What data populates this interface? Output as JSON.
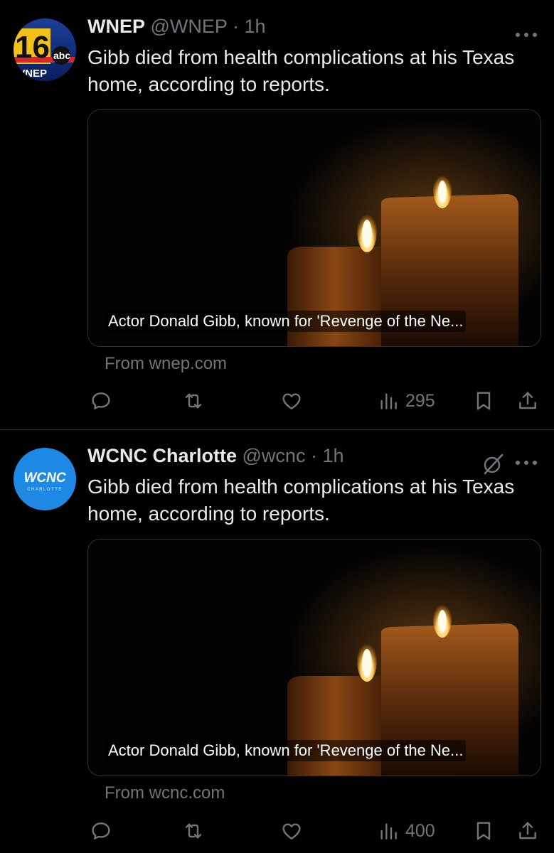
{
  "tweets": [
    {
      "avatar": {
        "label": "WNEP 16 abc logo",
        "big_text": "16",
        "sub_text": "WNEP",
        "network": "abc"
      },
      "name": "WNEP",
      "handle": "@WNEP",
      "separator": "·",
      "time": "1h",
      "text": "Gibb died from health complications at his Texas home, according to reports.",
      "card_caption": "Actor Donald Gibb, known for 'Revenge of the Ne...",
      "source": "From wnep.com",
      "views": "295",
      "show_grok": false
    },
    {
      "avatar": {
        "label": "WCNC Charlotte logo",
        "big_text": "WCNC",
        "sub_text": "CHARLOTTE"
      },
      "name": "WCNC Charlotte",
      "handle": "@wcnc",
      "separator": "·",
      "time": "1h",
      "text": "Gibb died from health complications at his Texas home, according to reports.",
      "card_caption": "Actor Donald Gibb, known for 'Revenge of the Ne...",
      "source": "From wcnc.com",
      "views": "400",
      "show_grok": true
    }
  ],
  "colors": {
    "background": "#000000",
    "text_primary": "#e7e9ea",
    "text_secondary": "#71767b",
    "divider": "#2f3336"
  },
  "icons": {
    "reply": "reply-icon",
    "retweet": "retweet-icon",
    "like": "like-icon",
    "views": "views-icon",
    "bookmark": "bookmark-icon",
    "share": "share-icon",
    "more": "more-icon",
    "grok": "grok-icon"
  }
}
